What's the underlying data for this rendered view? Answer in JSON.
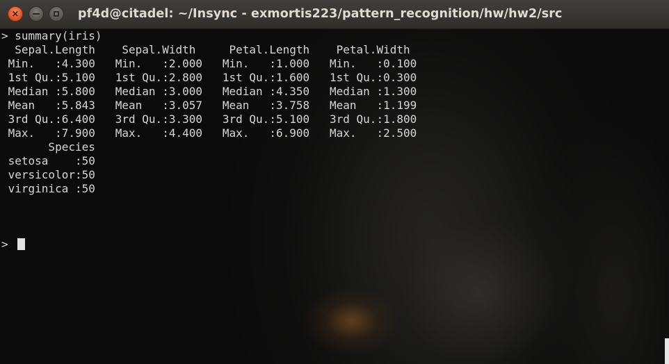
{
  "window": {
    "title": "pf4d@citadel: ~/Insync - exmortis223/pattern_recognition/hw/hw2/src",
    "buttons": {
      "close_icon": "×",
      "minimize_icon": "minimize-icon",
      "maximize_icon": "maximize-icon"
    }
  },
  "terminal": {
    "lines": [
      "> summary(iris)",
      "  Sepal.Length    Sepal.Width     Petal.Length    Petal.Width   ",
      " Min.   :4.300   Min.   :2.000   Min.   :1.000   Min.   :0.100  ",
      " 1st Qu.:5.100   1st Qu.:2.800   1st Qu.:1.600   1st Qu.:0.300  ",
      " Median :5.800   Median :3.000   Median :4.350   Median :1.300  ",
      " Mean   :5.843   Mean   :3.057   Mean   :3.758   Mean   :1.199  ",
      " 3rd Qu.:6.400   3rd Qu.:3.300   3rd Qu.:5.100   3rd Qu.:1.800  ",
      " Max.   :7.900   Max.   :4.400   Max.   :6.900   Max.   :2.500  ",
      "       Species  ",
      " setosa    :50  ",
      " versicolor:50  ",
      " virginica :50  ",
      "",
      "",
      "",
      ""
    ],
    "prompt": "> ",
    "colors": {
      "text": "#d6d6d6",
      "close_button": "#e1572c"
    }
  }
}
